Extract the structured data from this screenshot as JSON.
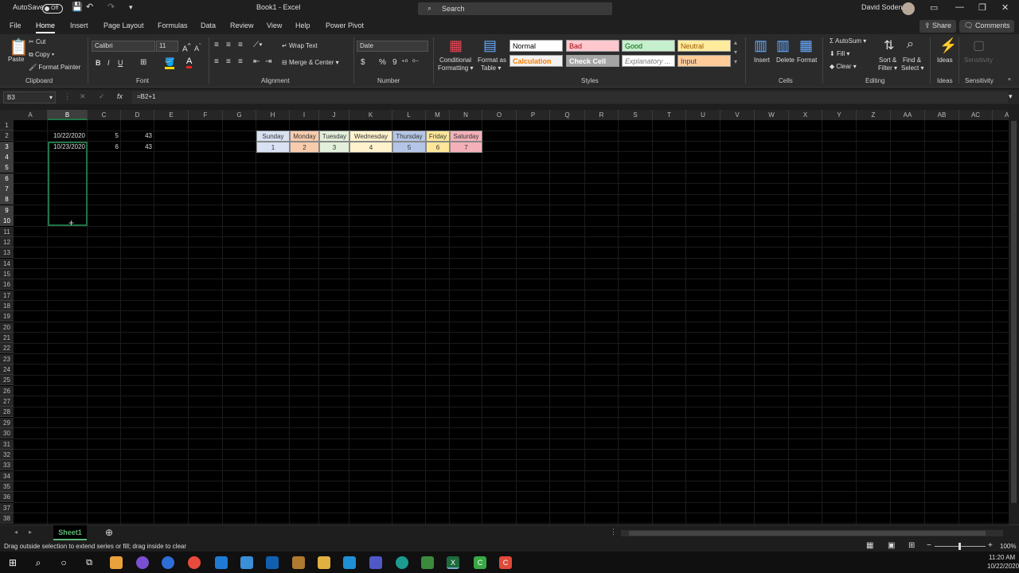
{
  "titlebar": {
    "autosave_label": "AutoSave",
    "autosave_state": "Off",
    "doc_title": "Book1 - Excel",
    "search_placeholder": "Search",
    "user_name": "David Soden"
  },
  "menu": {
    "tabs": [
      "File",
      "Home",
      "Insert",
      "Page Layout",
      "Formulas",
      "Data",
      "Review",
      "View",
      "Help",
      "Power Pivot"
    ],
    "active_tab": "Home",
    "share_label": "Share",
    "comments_label": "Comments"
  },
  "ribbon": {
    "clipboard": {
      "paste": "Paste",
      "cut": "Cut",
      "copy": "Copy",
      "format_painter": "Format Painter",
      "group": "Clipboard"
    },
    "font": {
      "name": "Calibri",
      "size": "11",
      "bold": "B",
      "italic": "I",
      "underline": "U",
      "group": "Font"
    },
    "alignment": {
      "wrap_text": "Wrap Text",
      "merge_center": "Merge & Center",
      "group": "Alignment"
    },
    "number": {
      "format": "Date",
      "currency": "$",
      "percent": "%",
      "comma": "9",
      "group": "Number"
    },
    "styles": {
      "conditional": "Conditional",
      "conditional2": "Formatting",
      "format_as": "Format as",
      "format_as2": "Table",
      "cells": [
        {
          "label": "Normal",
          "bg": "#ffffff",
          "fg": "#000000"
        },
        {
          "label": "Bad",
          "bg": "#ffc7ce",
          "fg": "#9c0006"
        },
        {
          "label": "Good",
          "bg": "#c6efce",
          "fg": "#006100"
        },
        {
          "label": "Neutral",
          "bg": "#ffeb9c",
          "fg": "#9c5700"
        },
        {
          "label": "Calculation",
          "bg": "#f2f2f2",
          "fg": "#fa7d00"
        },
        {
          "label": "Check Cell",
          "bg": "#a5a5a5",
          "fg": "#ffffff"
        },
        {
          "label": "Explanatory ...",
          "bg": "#ffffff",
          "fg": "#7f7f7f"
        },
        {
          "label": "Input",
          "bg": "#ffcc99",
          "fg": "#3f3f76"
        }
      ],
      "group": "Styles"
    },
    "cells": {
      "insert": "Insert",
      "delete": "Delete",
      "format": "Format",
      "group": "Cells"
    },
    "editing": {
      "autosum": "AutoSum",
      "fill": "Fill",
      "clear": "Clear",
      "sort": "Sort &",
      "sort2": "Filter",
      "find": "Find &",
      "find2": "Select",
      "group": "Editing"
    },
    "ideas": {
      "label": "Ideas",
      "group": "Ideas"
    },
    "sensitivity": {
      "label": "Sensitivity",
      "group": "Sensitivity"
    }
  },
  "formula_bar": {
    "name_box": "B3",
    "formula": "=B2+1"
  },
  "grid": {
    "columns": [
      "A",
      "B",
      "C",
      "D",
      "E",
      "F",
      "G",
      "H",
      "I",
      "J",
      "K",
      "L",
      "M",
      "N",
      "O",
      "P",
      "Q",
      "R",
      "S",
      "T",
      "U",
      "V",
      "W",
      "X",
      "Y",
      "Z",
      "AA",
      "AB",
      "AC",
      "AD"
    ],
    "selected_column": "B",
    "rows": [
      "1",
      "2",
      "3",
      "4",
      "5",
      "6",
      "7",
      "8",
      "9",
      "10",
      "11",
      "12",
      "13",
      "14",
      "15",
      "16",
      "17",
      "18",
      "19",
      "20",
      "21",
      "22",
      "23",
      "24",
      "25",
      "26",
      "27",
      "28",
      "29",
      "30",
      "31",
      "32",
      "33",
      "34",
      "35",
      "36",
      "37",
      "38"
    ],
    "selected_rows": [
      "3",
      "4",
      "5",
      "6",
      "7",
      "8",
      "9",
      "10"
    ],
    "cells": {
      "B2": "10/22/2020",
      "B3": "10/23/2020",
      "C2": "5",
      "C3": "6",
      "D2": "43",
      "D3": "43"
    },
    "days": [
      {
        "name": "Sunday",
        "num": "1",
        "bg": "#d9e1f2"
      },
      {
        "name": "Monday",
        "num": "2",
        "bg": "#f8cbad"
      },
      {
        "name": "Tuesday",
        "num": "3",
        "bg": "#e2efda"
      },
      {
        "name": "Wednesday",
        "num": "4",
        "bg": "#fff2cc"
      },
      {
        "name": "Thursday",
        "num": "5",
        "bg": "#b4c6e7"
      },
      {
        "name": "Friday",
        "num": "6",
        "bg": "#ffe699"
      },
      {
        "name": "Saturday",
        "num": "7",
        "bg": "#f4b0b8"
      }
    ]
  },
  "sheets": {
    "active": "Sheet1"
  },
  "status": {
    "message": "Drag outside selection to extend series or fill; drag inside to clear",
    "zoom": "100%"
  },
  "taskbar": {
    "time": "11:20 AM",
    "date": "10/22/2020"
  }
}
